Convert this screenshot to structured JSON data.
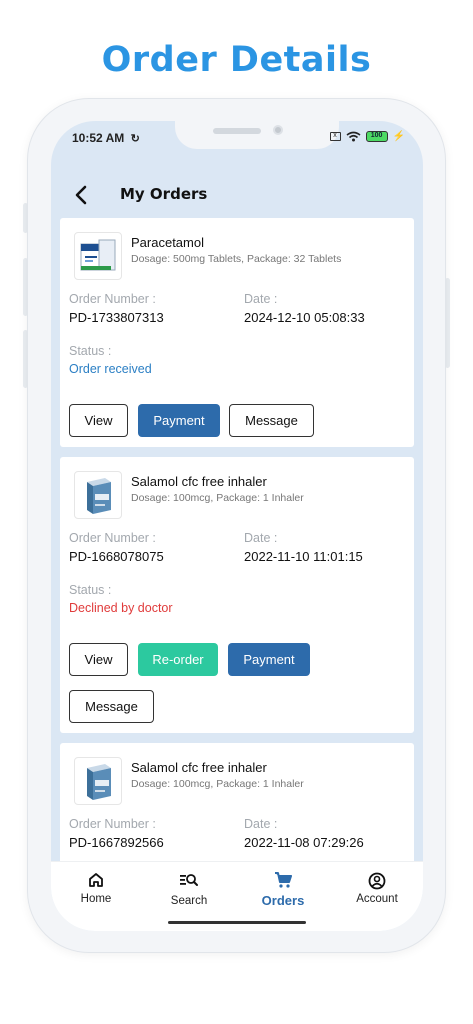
{
  "page": {
    "heading": "Order Details"
  },
  "status_bar": {
    "time": "10:52 AM",
    "battery": "100"
  },
  "header": {
    "title": "My Orders"
  },
  "labels": {
    "order_number": "Order Number :",
    "date": "Date :",
    "status": "Status :"
  },
  "orders": [
    {
      "product": "Paracetamol",
      "details": "Dosage: 500mg Tablets, Package: 32 Tablets",
      "order_number": "PD-1733807313",
      "date": "2024-12-10 05:08:33",
      "status": "Order received",
      "status_color": "#2b7fc4",
      "buttons": [
        "View",
        "Payment",
        "Message"
      ]
    },
    {
      "product": "Salamol cfc free inhaler",
      "details": "Dosage: 100mcg, Package: 1 Inhaler",
      "order_number": "PD-1668078075",
      "date": "2022-11-10 11:01:15",
      "status": "Declined by doctor",
      "status_color": "#e03b3b",
      "buttons": [
        "View",
        "Re-order",
        "Payment",
        "Message"
      ]
    },
    {
      "product": "Salamol cfc free inhaler",
      "details": "Dosage: 100mcg, Package: 1 Inhaler",
      "order_number": "PD-1667892566",
      "date": "2022-11-08 07:29:26"
    }
  ],
  "nav": [
    {
      "label": "Home",
      "icon": "home-icon"
    },
    {
      "label": "Search",
      "icon": "search-list-icon"
    },
    {
      "label": "Orders",
      "icon": "cart-icon",
      "active": true
    },
    {
      "label": "Account",
      "icon": "account-icon"
    }
  ],
  "colors": {
    "heading": "#2b95e3",
    "primary_button": "#2d6bab",
    "reorder_button": "#2cc99f",
    "declined": "#e03b3b",
    "received": "#2b7fc4",
    "screen_bg": "#dbe7f4"
  }
}
